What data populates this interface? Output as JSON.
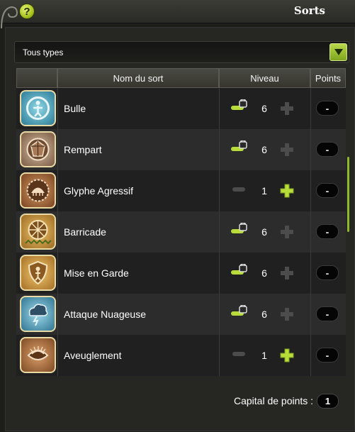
{
  "window": {
    "title": "Sorts",
    "help_label": "?"
  },
  "filter": {
    "selected": "Tous types"
  },
  "table": {
    "headers": {
      "name": "Nom du sort",
      "level": "Niveau",
      "points": "Points"
    },
    "rows": [
      {
        "name": "Bulle",
        "level": "6",
        "locked": true,
        "points_label": "-",
        "icon": "bubble-shield-icon",
        "icon_color": "#5aa9c2"
      },
      {
        "name": "Rempart",
        "level": "6",
        "locked": true,
        "points_label": "-",
        "icon": "rampart-shield-icon",
        "icon_color": "#9c7c62"
      },
      {
        "name": "Glyphe Agressif",
        "level": "1",
        "locked": false,
        "points_label": "-",
        "icon": "aggressive-glyph-icon",
        "icon_color": "#a56a3a"
      },
      {
        "name": "Barricade",
        "level": "6",
        "locked": true,
        "points_label": "-",
        "icon": "barricade-icon",
        "icon_color": "#c9933a"
      },
      {
        "name": "Mise en Garde",
        "level": "6",
        "locked": true,
        "points_label": "-",
        "icon": "guard-shield-icon",
        "icon_color": "#c98f3a"
      },
      {
        "name": "Attaque Nuageuse",
        "level": "6",
        "locked": true,
        "points_label": "-",
        "icon": "storm-cloud-icon",
        "icon_color": "#4f9ab8"
      },
      {
        "name": "Aveuglement",
        "level": "1",
        "locked": false,
        "points_label": "-",
        "icon": "blinding-eye-icon",
        "icon_color": "#b2703a"
      }
    ]
  },
  "footer": {
    "capital_label": "Capital de points :",
    "capital_value": "1"
  },
  "colors": {
    "accent": "#a8c21f",
    "background": "#1d1d1a"
  }
}
